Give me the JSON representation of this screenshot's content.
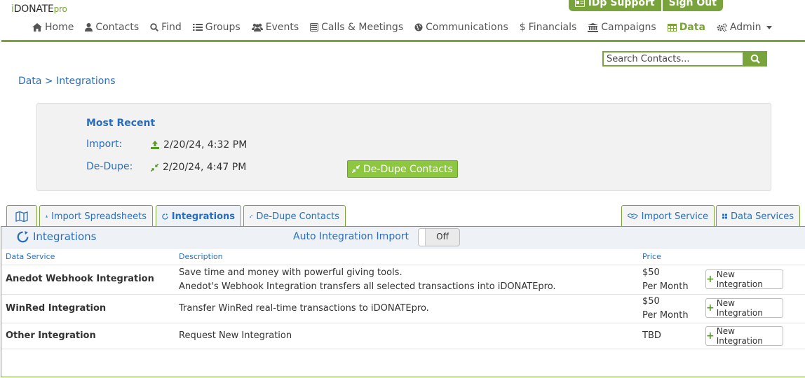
{
  "brand": {
    "prefix": "i",
    "main": "DONATE",
    "suffix": "pro"
  },
  "top_buttons": {
    "support": "iDp Support",
    "signout": "Sign Out"
  },
  "nav": [
    {
      "label": "Home",
      "icon": "home-icon"
    },
    {
      "label": "Contacts",
      "icon": "user-icon"
    },
    {
      "label": "Find",
      "icon": "search-icon"
    },
    {
      "label": "Groups",
      "icon": "list-icon"
    },
    {
      "label": "Events",
      "icon": "users-icon"
    },
    {
      "label": "Calls & Meetings",
      "icon": "phone-icon"
    },
    {
      "label": "Communications",
      "icon": "globe-icon"
    },
    {
      "label": "Financials",
      "icon": "dollar-icon"
    },
    {
      "label": "Campaigns",
      "icon": "bank-icon"
    },
    {
      "label": "Data",
      "icon": "table-icon"
    },
    {
      "label": "Admin",
      "icon": "gears-icon"
    }
  ],
  "search": {
    "placeholder": "Search Contacts..."
  },
  "breadcrumb": "Data > Integrations",
  "recent": {
    "title": "Most Recent",
    "import_label": "Import:",
    "import_value": "2/20/24, 4:32 PM",
    "dedupe_label": "De-Dupe:",
    "dedupe_value": "2/20/24, 4:47 PM",
    "dedupe_button": "De-Dupe Contacts"
  },
  "tabs": {
    "import_spreadsheets": "Import Spreadsheets",
    "integrations": "Integrations",
    "dedupe": "De-Dupe Contacts",
    "import_service": "Import Service",
    "data_services": "Data Services"
  },
  "panel": {
    "title": "Integrations",
    "auto_label": "Auto Integration Import",
    "toggle_state": "Off",
    "columns": {
      "service": "Data Service",
      "description": "Description",
      "price": "Price"
    }
  },
  "rows": [
    {
      "name": "Anedot Webhook Integration",
      "desc1": "Save time and money with powerful giving tools.",
      "desc2": "Anedot's Webhook Integration transfers all selected transactions into iDONATEpro.",
      "price1": "$50",
      "price2": "Per Month",
      "button": "New Integration"
    },
    {
      "name": "WinRed Integration",
      "desc1": "Transfer WinRed real-time transactions to iDONATEpro.",
      "desc2": "",
      "price1": "$50",
      "price2": "Per Month",
      "button": "New Integration"
    },
    {
      "name": "Other Integration",
      "desc1": "Request New Integration",
      "desc2": "",
      "price1": "TBD",
      "price2": "",
      "button": "New Integration"
    }
  ],
  "colors": {
    "brand_green": "#79a43b",
    "link_blue": "#2a6ebb",
    "button_green": "#8dc63f"
  }
}
